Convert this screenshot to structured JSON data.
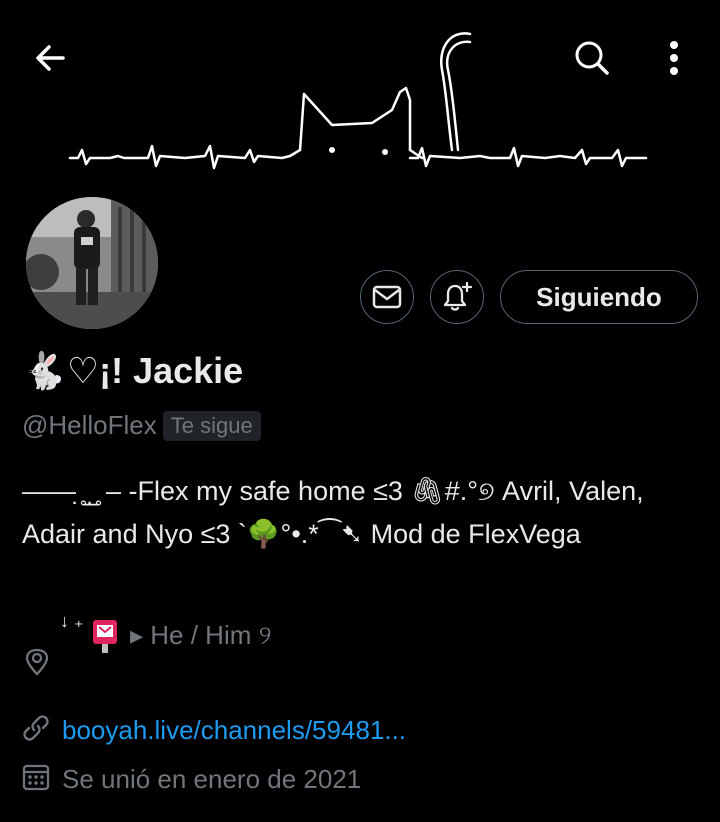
{
  "header": {
    "back_icon": "arrow-left-icon",
    "search_icon": "search-icon",
    "more_icon": "more-vertical-icon",
    "banner_art": "heartbeat-cat-line-art"
  },
  "profile": {
    "display_name": "🐇♡¡! Jackie",
    "handle": "@HelloFlex",
    "follows_you_badge": "Te sigue",
    "bio": "—— ̣̥ ̲ ̣̥ – -Flex my safe home ≤3 🖇#.°୭ Avril, Valen, Adair and Nyo ≤3 `🌳°•.*⁀➷ Mod de FlexVega",
    "location_deco": "↓ ₊",
    "location_text": "▸ He / Him ୨",
    "website": "booyah.live/channels/59481...",
    "joined": "Se unió en enero de 2021"
  },
  "actions": {
    "message_icon": "envelope-icon",
    "notify_icon": "bell-plus-icon",
    "follow_label": "Siguiendo"
  },
  "colors": {
    "background": "#000000",
    "text_primary": "#e7e9ea",
    "text_secondary": "#71767b",
    "link": "#1d9bf0",
    "border": "#536471",
    "badge_bg": "#202327"
  }
}
